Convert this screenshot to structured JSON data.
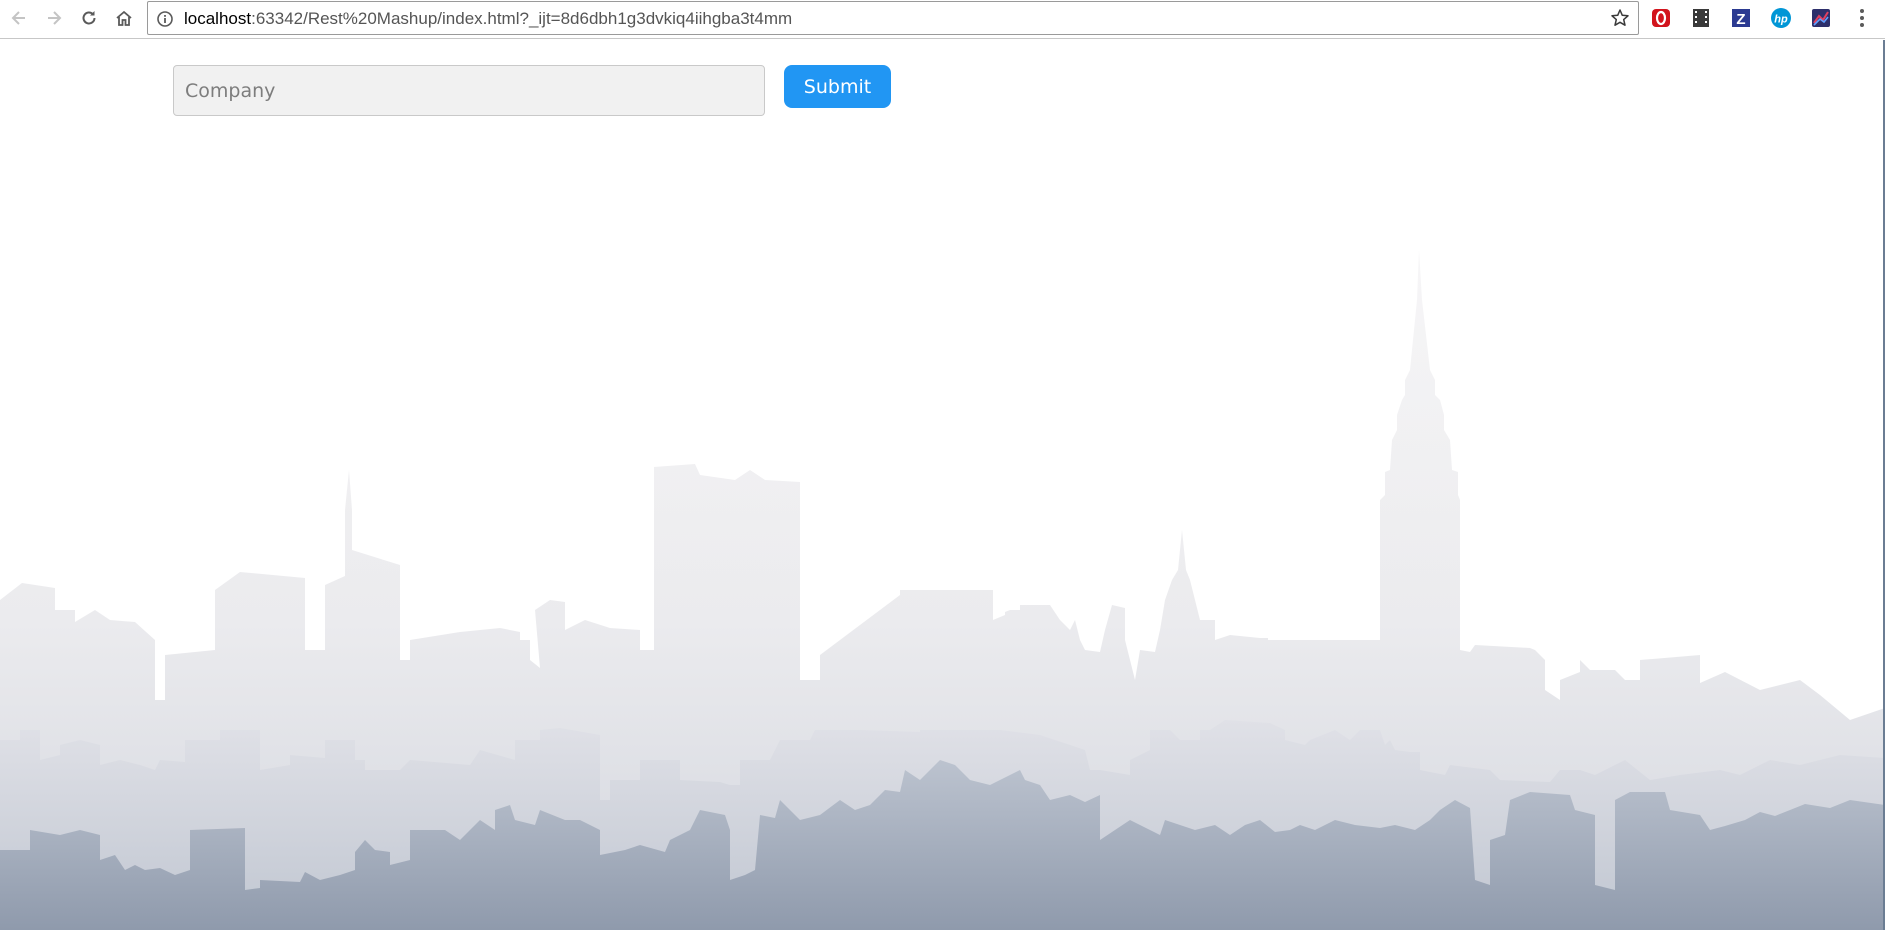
{
  "browser": {
    "url_host": "localhost",
    "url_rest": ":63342/Rest%20Mashup/index.html?_ijt=8d6dbh1g3dvkiq4iihgba3t4mm",
    "icons": {
      "back": "back-arrow-icon",
      "forward": "forward-arrow-icon",
      "reload": "reload-icon",
      "home": "home-icon",
      "info": "info-icon",
      "bookmark": "star-icon",
      "menu": "menu-dots-icon"
    },
    "extensions": [
      {
        "name": "opera-extension-icon",
        "letter": "",
        "color": "#d2141d"
      },
      {
        "name": "film-extension-icon",
        "letter": "",
        "color": "#3a3a3a"
      },
      {
        "name": "zotero-extension-icon",
        "letter": "Z",
        "color": "#2b3a91"
      },
      {
        "name": "hp-extension-icon",
        "letter": "hp",
        "color": "#0096d6"
      },
      {
        "name": "chart-extension-icon",
        "letter": "",
        "color": "#2d2f6b"
      }
    ]
  },
  "form": {
    "company_placeholder": "Company",
    "company_value": "",
    "submit_label": "Submit"
  },
  "colors": {
    "submit_bg": "#2196f3",
    "input_bg": "#f1f1f1",
    "skyline_top": "#f2f2f5",
    "skyline_bottom": "#8e9aad"
  }
}
